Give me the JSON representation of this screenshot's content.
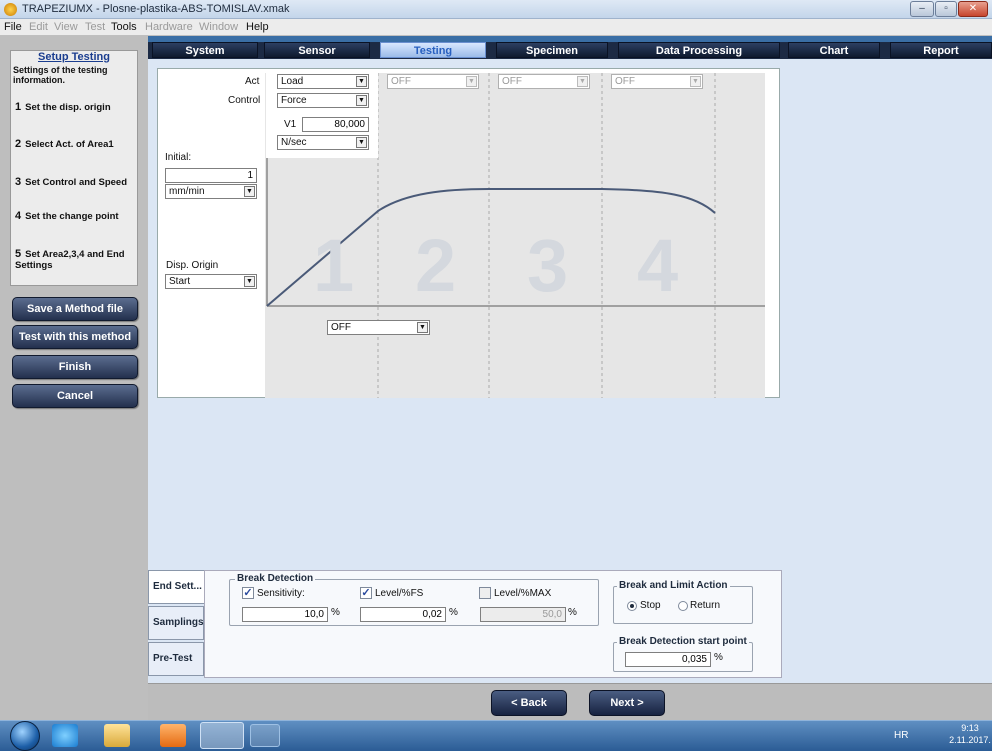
{
  "window": {
    "title": "TRAPEZIUMX - Plosne-plastika-ABS-TOMISLAV.xmak"
  },
  "menu": [
    {
      "label": "File",
      "enabled": true
    },
    {
      "label": "Edit",
      "enabled": false
    },
    {
      "label": "View",
      "enabled": false
    },
    {
      "label": "Test",
      "enabled": false
    },
    {
      "label": "Tools",
      "enabled": true
    },
    {
      "label": "Hardware",
      "enabled": false
    },
    {
      "label": "Window",
      "enabled": false
    },
    {
      "label": "Help",
      "enabled": true
    }
  ],
  "sidebar": {
    "title": "Setup Testing",
    "description": "Settings of the testing information.",
    "steps": [
      {
        "num": "1",
        "label": "Set the disp. origin"
      },
      {
        "num": "2",
        "label": "Select Act. of Area1"
      },
      {
        "num": "3",
        "label": "Set Control and Speed"
      },
      {
        "num": "4",
        "label": "Set the change point"
      },
      {
        "num": "5",
        "label": "Set Area2,3,4 and End Settings"
      }
    ],
    "buttons": [
      "Save a Method file",
      "Test with this method",
      "Finish",
      "Cancel"
    ]
  },
  "tabs": [
    {
      "label": "System"
    },
    {
      "label": "Sensor"
    },
    {
      "label": "Testing",
      "active": true
    },
    {
      "label": "Specimen"
    },
    {
      "label": "Data Processing"
    },
    {
      "label": "Chart"
    },
    {
      "label": "Report"
    }
  ],
  "testing": {
    "act_label": "Act",
    "control_label": "Control",
    "act": "Load",
    "control": "Force",
    "area2": "OFF",
    "area3": "OFF",
    "area4": "OFF",
    "v1_label": "V1",
    "v1": "80,000",
    "speed_unit": "N/sec",
    "initial_label": "Initial:",
    "initial_value": "1",
    "initial_unit": "mm/min",
    "disp_origin_label": "Disp. Origin",
    "disp_origin": "Start",
    "change_point": "OFF",
    "area_numbers": [
      "1",
      "2",
      "3",
      "4"
    ]
  },
  "bottom_tabs": [
    "End Sett...",
    "Samplings",
    "Pre-Test"
  ],
  "end_settings": {
    "break_detection_title": "Break Detection",
    "sensitivity_label": "Sensitivity:",
    "sensitivity_checked": true,
    "sensitivity_value": "10,0",
    "level_fs_label": "Level/%FS",
    "level_fs_checked": true,
    "level_fs_value": "0,02",
    "level_max_label": "Level/%MAX",
    "level_max_checked": false,
    "level_max_value": "50,0",
    "percent": "%",
    "break_limit_title": "Break and Limit Action",
    "stop_label": "Stop",
    "return_label": "Return",
    "selected_action": "Stop",
    "start_point_title": "Break Detection start point",
    "start_point_value": "0,035"
  },
  "footer": {
    "back": "< Back",
    "next": "Next >"
  },
  "taskbar": {
    "lang": "HR",
    "time": "9:13",
    "date": "2.11.2017."
  }
}
